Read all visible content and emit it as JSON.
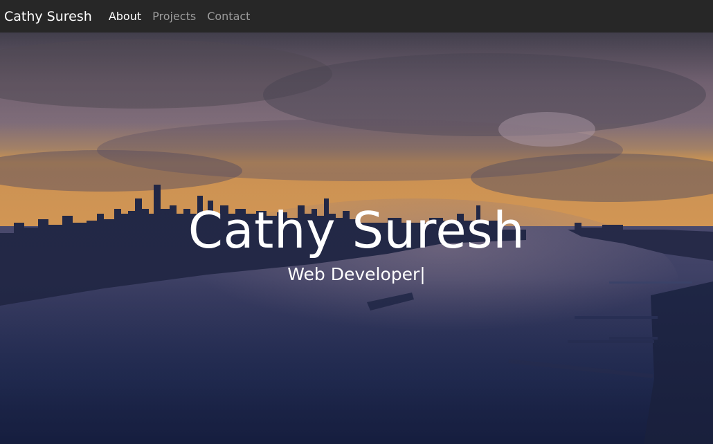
{
  "navbar": {
    "brand": "Cathy Suresh",
    "links": [
      {
        "label": "About",
        "active": true
      },
      {
        "label": "Projects",
        "active": false
      },
      {
        "label": "Contact",
        "active": false
      }
    ]
  },
  "hero": {
    "title": "Cathy Suresh",
    "subtitle": "Web Developer",
    "cursor": "|",
    "background": "city-skyline-river-dusk-photo"
  },
  "colors": {
    "navbar_bg": "#272727",
    "nav_active": "#ffffff",
    "nav_inactive": "#9d9d9d",
    "hero_text": "#ffffff"
  }
}
